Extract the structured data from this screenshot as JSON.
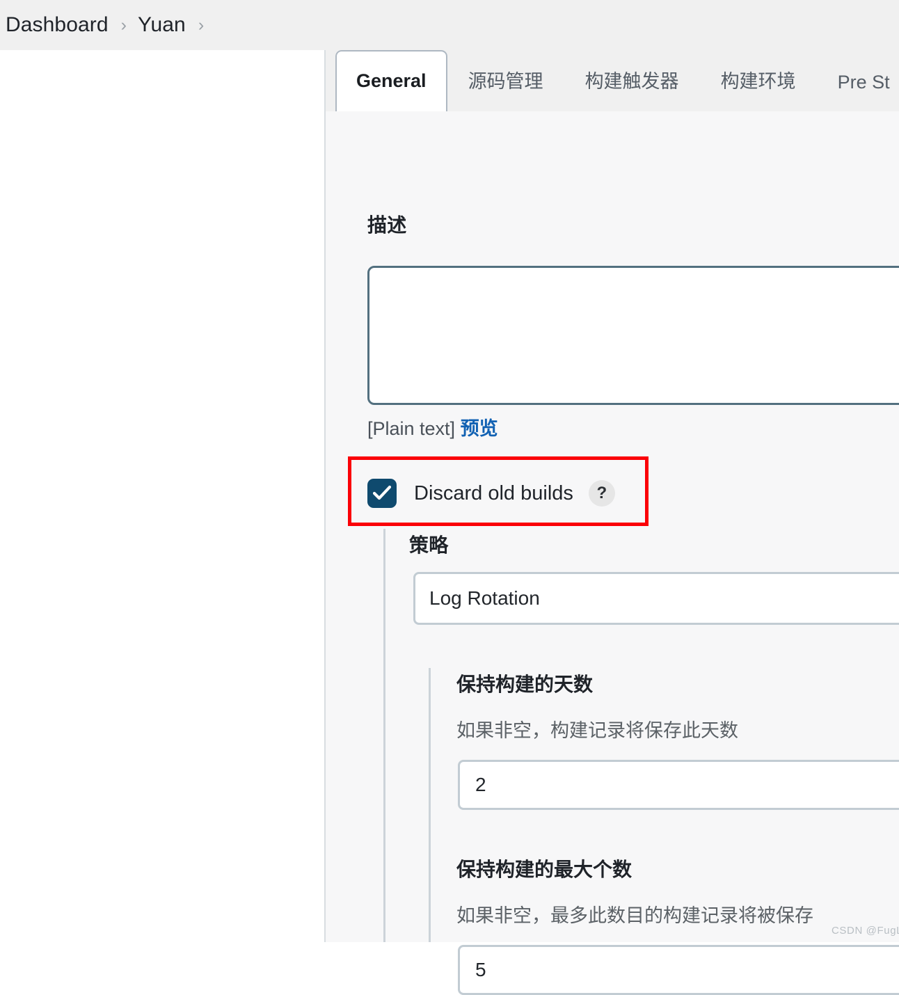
{
  "breadcrumb": {
    "items": [
      "Dashboard",
      "Yuan"
    ],
    "separator": "›"
  },
  "tabs": [
    {
      "label": "General",
      "active": true
    },
    {
      "label": "源码管理",
      "active": false
    },
    {
      "label": "构建触发器",
      "active": false
    },
    {
      "label": "构建环境",
      "active": false
    },
    {
      "label": "Pre St",
      "active": false
    }
  ],
  "form": {
    "description": {
      "label": "描述",
      "value": "",
      "placeholder": "",
      "markup_note": "[Plain text]",
      "preview_link": "预览"
    },
    "discard_old_builds": {
      "label": "Discard old builds",
      "checked": true,
      "help_icon": "?"
    },
    "strategy": {
      "label": "策略",
      "selected": "Log Rotation"
    },
    "days_to_keep": {
      "title": "保持构建的天数",
      "description": "如果非空，构建记录将保存此天数",
      "value": "2"
    },
    "max_builds_to_keep": {
      "title": "保持构建的最大个数",
      "description": "如果非空，最多此数目的构建记录将被保存",
      "value": "5"
    }
  },
  "watermark": "CSDN @FugLee",
  "colors": {
    "checkbox_fill": "#0f4a6e",
    "highlight_border": "#fb0007",
    "link": "#1262b3",
    "focus_border": "#53707f",
    "field_border": "#c2ccd3",
    "header_bg": "#f0f0f0",
    "content_bg": "#f7f7f8"
  }
}
